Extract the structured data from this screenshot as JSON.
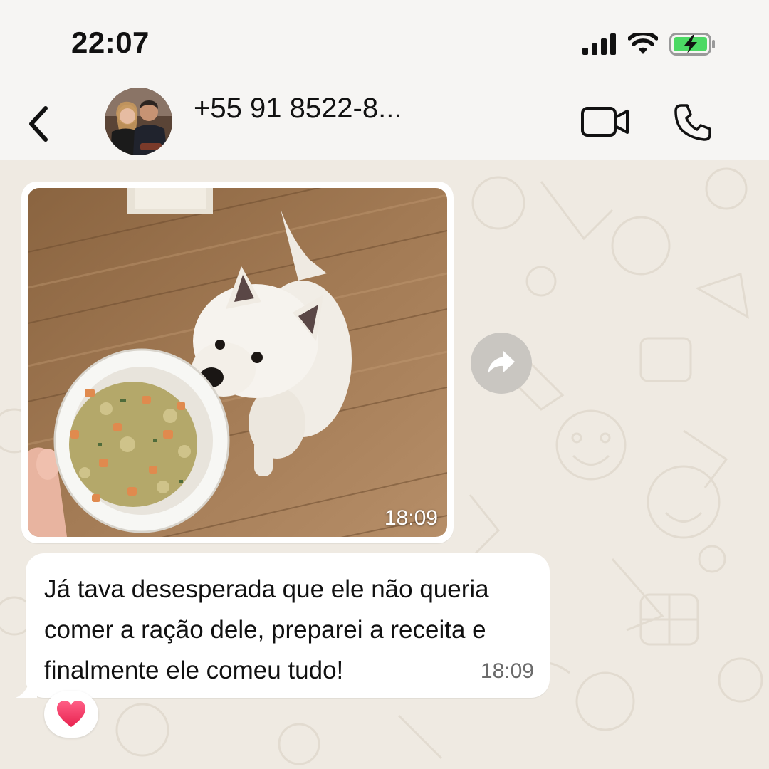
{
  "status_bar": {
    "time": "22:07",
    "icons": [
      "signal-icon",
      "wifi-icon",
      "battery-charging-icon"
    ]
  },
  "header": {
    "back_icon": "chevron-left-icon",
    "contact_name": "+55 91 8522-8...",
    "actions": [
      "video-call-icon",
      "phone-call-icon"
    ]
  },
  "messages": [
    {
      "type": "image",
      "image_description_icon": "dog-with-food-bowl-photo",
      "time": "18:09"
    },
    {
      "type": "text",
      "text": "Já tava desesperada que ele não queria\ncomer a ração dele, preparei a receita e\nfinalmente ele comeu tudo!",
      "time": "18:09",
      "reaction": "heart"
    }
  ],
  "colors": {
    "chat_bg": "#efeae2",
    "bubble": "#ffffff",
    "header_bg": "#f6f5f3",
    "battery_green": "#4cd964"
  }
}
